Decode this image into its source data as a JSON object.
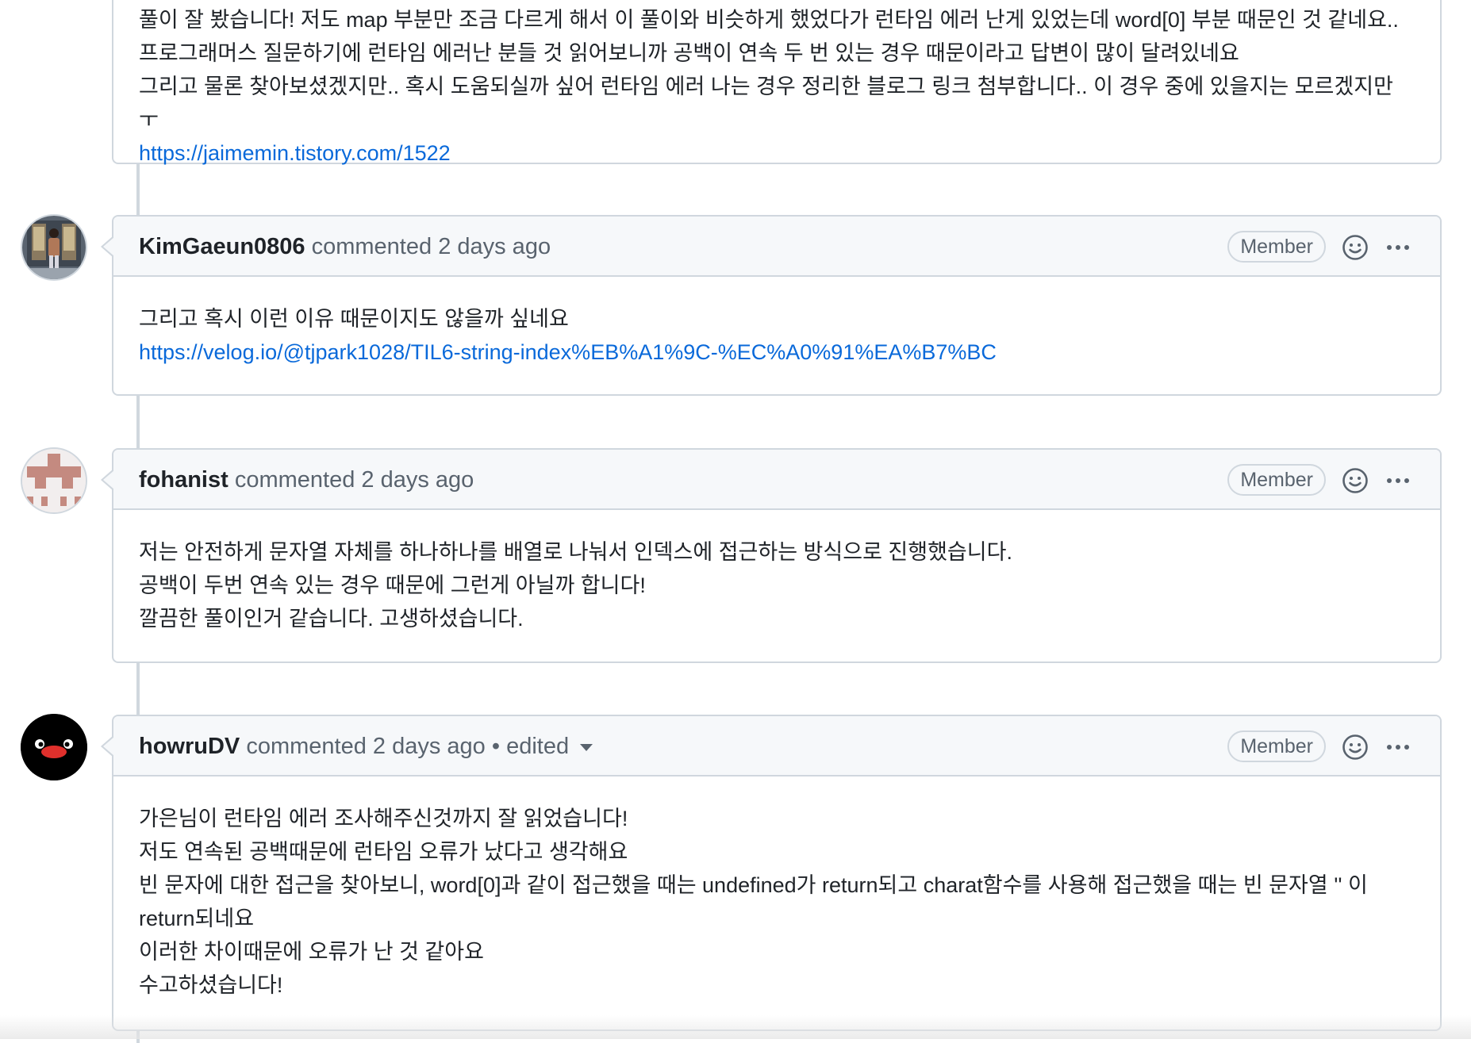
{
  "comments": [
    {
      "body_lines": [
        "풀이 잘 봤습니다! 저도 map 부분만 조금 다르게 해서 이 풀이와 비슷하게 했었다가 런타임 에러 난게 있었는데 word[0] 부분 때문인 것 같네요..",
        "프로그래머스 질문하기에 런타임 에러난 분들 것 읽어보니까 공백이 연속 두 번 있는 경우 때문이라고 답변이 많이 달려있네요",
        "그리고 물론 찾아보셨겠지만.. 혹시 도움되실까 싶어 런타임 에러 나는 경우 정리한 블로그 링크 첨부합니다.. 이 경우 중에 있을지는 모르겠지만 ㅜ"
      ],
      "link": "https://jaimemin.tistory.com/1522"
    },
    {
      "author": "KimGaeun0806",
      "action": "commented",
      "time": "2 days ago",
      "badge": "Member",
      "body_lines": [
        "그리고 혹시 이런 이유 때문이지도 않을까 싶네요"
      ],
      "link": "https://velog.io/@tjpark1028/TIL6-string-index%EB%A1%9C-%EC%A0%91%EA%B7%BC"
    },
    {
      "author": "fohanist",
      "action": "commented",
      "time": "2 days ago",
      "badge": "Member",
      "body_lines": [
        "저는 안전하게 문자열 자체를 하나하나를 배열로 나눠서 인덱스에 접근하는 방식으로 진행했습니다.",
        "공백이 두번 연속 있는 경우 때문에 그런게 아닐까 합니다!",
        "깔끔한 풀이인거 같습니다. 고생하셨습니다."
      ]
    },
    {
      "author": "howruDV",
      "action": "commented",
      "time": "2 days ago",
      "separator": "•",
      "edited": "edited",
      "badge": "Member",
      "body_lines": [
        "가은님이 런타임 에러 조사해주신것까지 잘 읽었습니다!",
        "저도 연속된 공백때문에 런타임 오류가 났다고 생각해요",
        "빈 문자에 대한 접근을 찾아보니, word[0]과 같이 접근했을 때는 undefined가 return되고 charat함수를 사용해 접근했을 때는 빈 문자열 '' 이",
        "return되네요",
        "이러한 차이때문에 오류가 난 것 같아요",
        "수고하셨습니다!"
      ]
    }
  ],
  "icons": {
    "reaction": "smiley-icon",
    "menu": "kebab-horizontal-icon",
    "edited_dropdown": "caret-down-icon"
  },
  "colors": {
    "link": "#0969da",
    "border": "#d0d7de",
    "header_bg": "#f6f8fa",
    "muted": "#59636e"
  }
}
